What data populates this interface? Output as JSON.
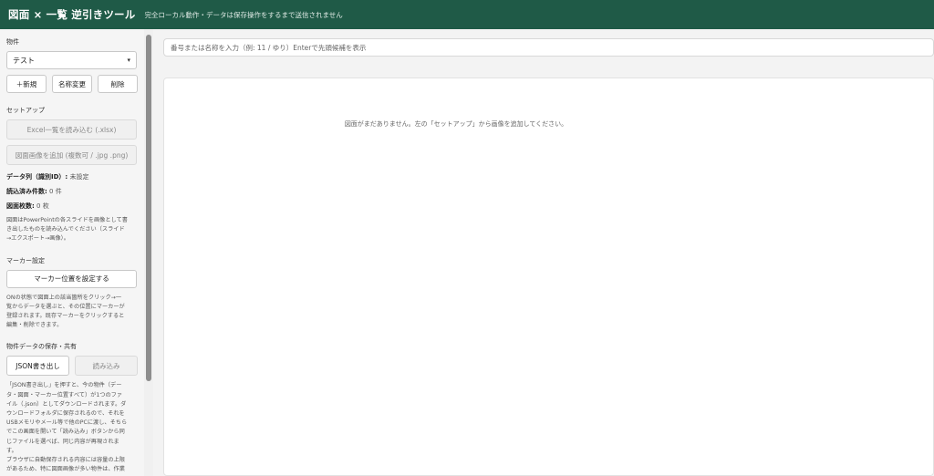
{
  "header": {
    "title": "図面 × 一覧 逆引きツール",
    "subtitle": "完全ローカル動作・データは保存操作をするまで送信されません"
  },
  "sidebar": {
    "property_label": "物件",
    "property_selected": "テスト",
    "buttons": {
      "new": "＋新規",
      "rename": "名称変更",
      "delete": "削除"
    },
    "setup_label": "セットアップ",
    "excel_button": "Excel一覧を読み込む (.xlsx)",
    "image_button": "図面画像を追加 (複数可 / .jpg .png)",
    "data_column_label": "データ列（識別ID）:",
    "data_column_value": "未設定",
    "loaded_count_label": "読込済み件数:",
    "loaded_count_value": "0 件",
    "drawing_count_label": "図面枚数:",
    "drawing_count_value": "0 枚",
    "setup_note_1": "図面はPowerPointの各スライドを画像として書",
    "setup_note_2": "き出したものを読み込んでください（スライド",
    "setup_note_3": "→エクスポート→画像）。",
    "marker_label": "マーカー設定",
    "marker_button": "マーカー位置を設定する",
    "marker_note_1": "ONの状態で図面上の該当箇所をクリック→一",
    "marker_note_2": "覧からデータを選ぶと、その位置にマーカーが",
    "marker_note_3": "登録されます。既存マーカーをクリックすると",
    "marker_note_4": "編集・削除できます。",
    "save_label": "物件データの保存・共有",
    "json_export": "JSON書き出し",
    "json_import": "読み込み",
    "save_note_1": "「JSON書き出し」を押すと、今の物件（デー",
    "save_note_2": "タ・図面・マーカー位置すべて）が1つのファ",
    "save_note_3": "イル（.json）としてダウンロードされます。ダ",
    "save_note_4": "ウンロードフォルダに保存されるので、それを",
    "save_note_5": "USBメモリやメール等で他のPCに渡し、そちら",
    "save_note_6": "でこの画面を開いて「読み込み」ボタンから同",
    "save_note_7": "じファイルを選べば、同じ内容が再現されま",
    "save_note_8": "す。",
    "save_note_9": "ブラウザに自動保存される内容には容量の上限",
    "save_note_10": "があるため、特に図面画像が多い物件は、作業"
  },
  "main": {
    "search_placeholder": "番号または名称を入力（例: 11 / ゆり）Enterで先頭候補を表示",
    "empty_message": "図面がまだありません。左の「セットアップ」から画像を追加してください。"
  }
}
